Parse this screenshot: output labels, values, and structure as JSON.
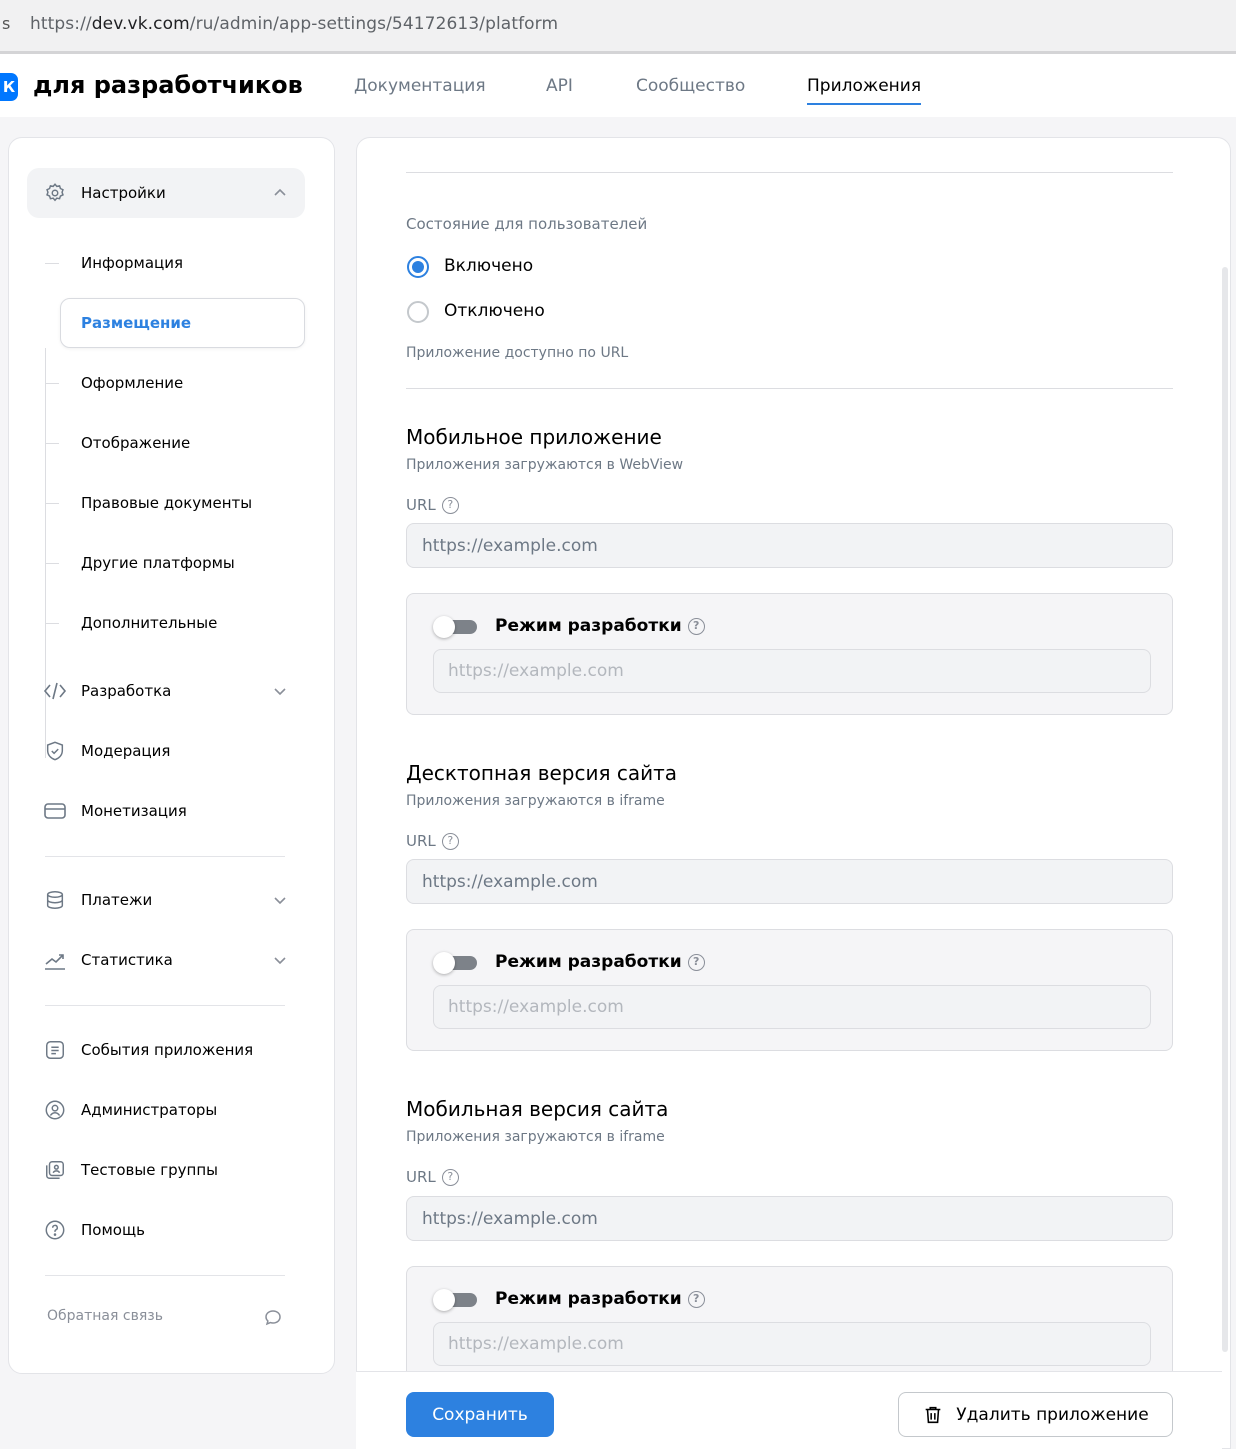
{
  "browser": {
    "lead_glyph": "s",
    "url_scheme": "https://",
    "url_host": "dev.vk.com",
    "url_path": "/ru/admin/app-settings/54172613/platform"
  },
  "topnav": {
    "logo_glyph": "К",
    "brand": "для разработчиков",
    "links": [
      "Документация",
      "API",
      "Сообщество",
      "Приложения"
    ],
    "active_link": "Приложения"
  },
  "sidebar": {
    "settings_label": "Настройки",
    "settings_items": [
      "Информация",
      "Размещение",
      "Оформление",
      "Отображение",
      "Правовые документы",
      "Другие платформы",
      "Дополнительные"
    ],
    "active_item": "Размещение",
    "items": [
      {
        "label": "Разработка",
        "icon": "code-icon"
      },
      {
        "label": "Модерация",
        "icon": "shield-check-icon"
      },
      {
        "label": "Монетизация",
        "icon": "card-icon"
      },
      {
        "label": "Платежи",
        "icon": "database-icon"
      },
      {
        "label": "Статистика",
        "icon": "chart-icon"
      },
      {
        "label": "События приложения",
        "icon": "list-icon"
      },
      {
        "label": "Администраторы",
        "icon": "user-circle-icon"
      },
      {
        "label": "Тестовые группы",
        "icon": "group-icon"
      },
      {
        "label": "Помощь",
        "icon": "question-icon"
      }
    ],
    "feedback": "Обратная связь"
  },
  "main": {
    "state_title": "Состояние для пользователей",
    "state_on": "Включено",
    "state_off": "Отключено",
    "state_selected": "Включено",
    "state_hint": "Приложение доступно по URL",
    "url_label": "URL",
    "help_glyph": "?",
    "dev_mode_label": "Режим разработки",
    "url_placeholder": "https://example.com",
    "sections": [
      {
        "title": "Мобильное приложение",
        "subtitle": "Приложения загружаются в WebView"
      },
      {
        "title": "Десктопная версия сайта",
        "subtitle": "Приложения загружаются в iframe"
      },
      {
        "title": "Мобильная версия сайта",
        "subtitle": "Приложения загружаются в iframe"
      }
    ]
  },
  "footer": {
    "save": "Сохранить",
    "delete": "Удалить приложение"
  },
  "colors": {
    "accent": "#2d81e0",
    "muted_text": "#6d7885",
    "page_bg": "#f5f5f7"
  }
}
